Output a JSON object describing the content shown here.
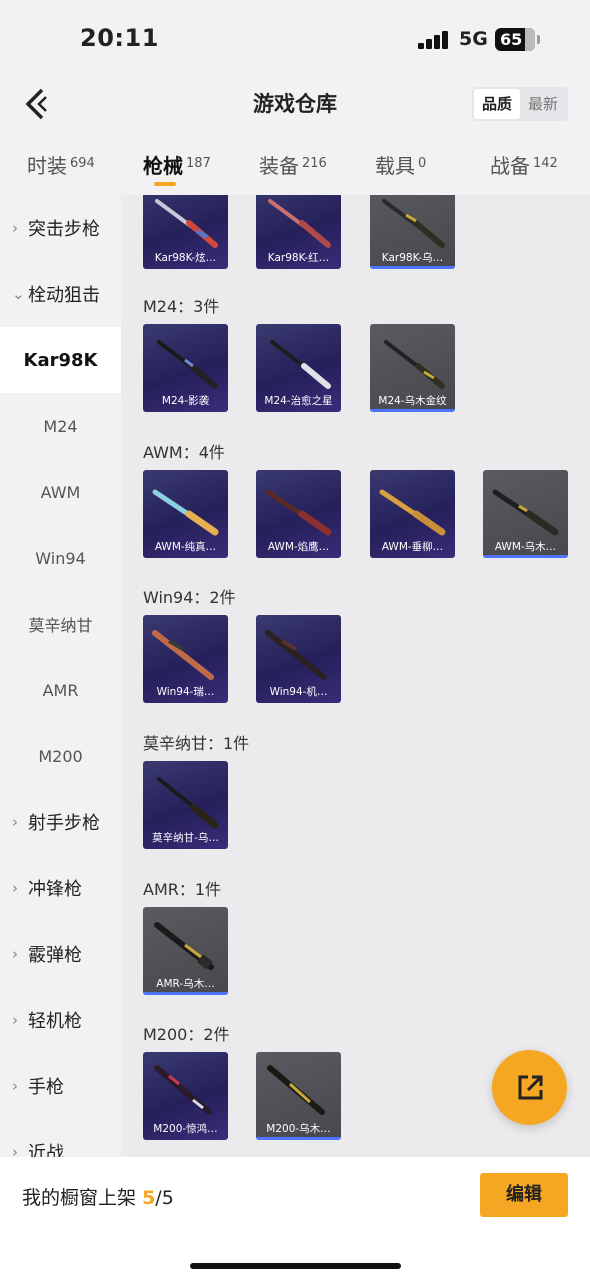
{
  "status": {
    "time": "20:11",
    "network": "5G",
    "battery": "65"
  },
  "header": {
    "title": "游戏仓库",
    "sort": [
      "品质",
      "最新"
    ]
  },
  "tabs": [
    {
      "label": "时装",
      "count": "694"
    },
    {
      "label": "枪械",
      "count": "187"
    },
    {
      "label": "装备",
      "count": "216"
    },
    {
      "label": "载具",
      "count": "0"
    },
    {
      "label": "战备",
      "count": "142"
    }
  ],
  "sidebar": {
    "assault": "突击步枪",
    "bolt": "栓动狙击",
    "kar98k": "Kar98K",
    "m24": "M24",
    "awm": "AWM",
    "win94": "Win94",
    "mosin": "莫辛纳甘",
    "amr": "AMR",
    "m200": "M200",
    "dmr": "射手步枪",
    "smg": "冲锋枪",
    "shotgun": "霰弹枪",
    "lmg": "轻机枪",
    "pistol": "手枪",
    "melee": "近战"
  },
  "sections": {
    "kar98k": {
      "cards": [
        "Kar98K-炫…",
        "Kar98K-红…",
        "Kar98K-乌…"
      ]
    },
    "m24": {
      "title": "M24：3件",
      "cards": [
        "M24-影袭",
        "M24-治愈之星",
        "M24-乌木金纹"
      ]
    },
    "awm": {
      "title": "AWM：4件",
      "cards": [
        "AWM-纯真…",
        "AWM-焰鹰…",
        "AWM-垂柳…",
        "AWM-乌木…"
      ]
    },
    "win94": {
      "title": "Win94：2件",
      "cards": [
        "Win94-瑞…",
        "Win94-机…"
      ]
    },
    "mosin": {
      "title": "莫辛纳甘：1件",
      "cards": [
        "莫辛纳甘-乌…"
      ]
    },
    "amr": {
      "title": "AMR：1件",
      "cards": [
        "AMR-乌木…"
      ]
    },
    "m200": {
      "title": "M200：2件",
      "cards": [
        "M200-惊鸿…",
        "M200-乌木…"
      ]
    }
  },
  "bottom": {
    "showcase_label": "我的橱窗上架",
    "current": "5",
    "total": "/5",
    "edit": "编辑"
  }
}
